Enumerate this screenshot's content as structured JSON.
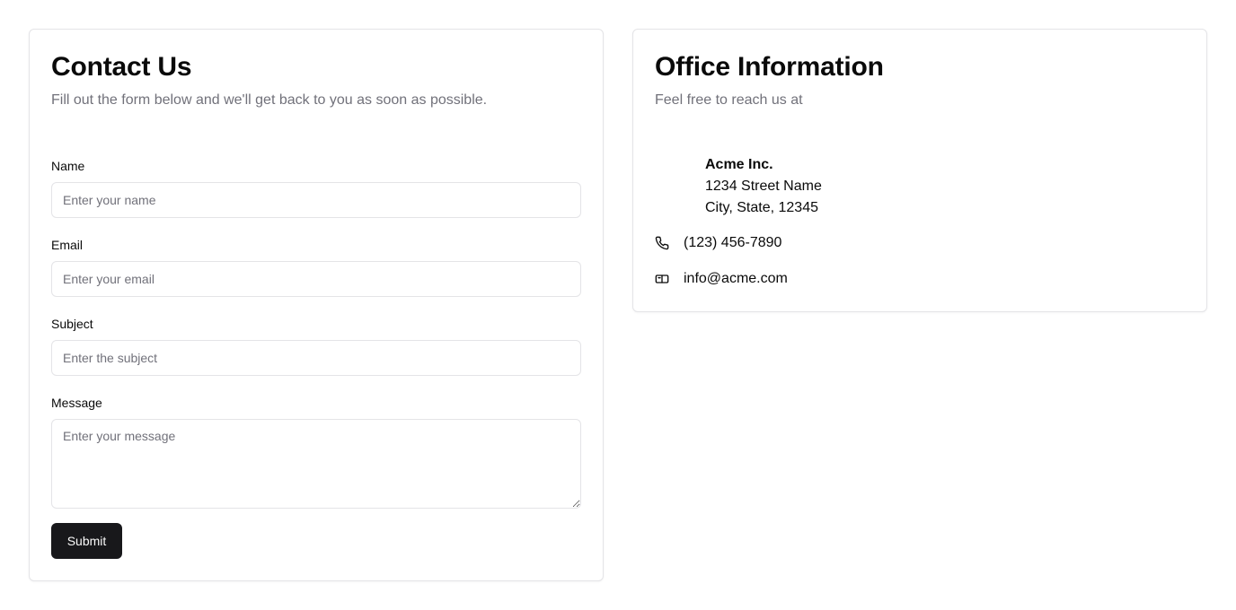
{
  "contact": {
    "title": "Contact Us",
    "description": "Fill out the form below and we'll get back to you as soon as possible.",
    "fields": {
      "name": {
        "label": "Name",
        "placeholder": "Enter your name",
        "value": ""
      },
      "email": {
        "label": "Email",
        "placeholder": "Enter your email",
        "value": ""
      },
      "subject": {
        "label": "Subject",
        "placeholder": "Enter the subject",
        "value": ""
      },
      "message": {
        "label": "Message",
        "placeholder": "Enter your message",
        "value": ""
      }
    },
    "submit_label": "Submit"
  },
  "office": {
    "title": "Office Information",
    "description": "Feel free to reach us at",
    "address": {
      "company": "Acme Inc.",
      "street": "1234 Street Name",
      "city": "City, State, 12345"
    },
    "phone": {
      "icon": "phone-icon",
      "value": "(123) 456-7890"
    },
    "email": {
      "icon": "mail-icon",
      "value": "info@acme.com"
    }
  },
  "colors": {
    "primary_button": "#18181b",
    "muted_text": "#71717a",
    "border": "#e4e4e7"
  }
}
